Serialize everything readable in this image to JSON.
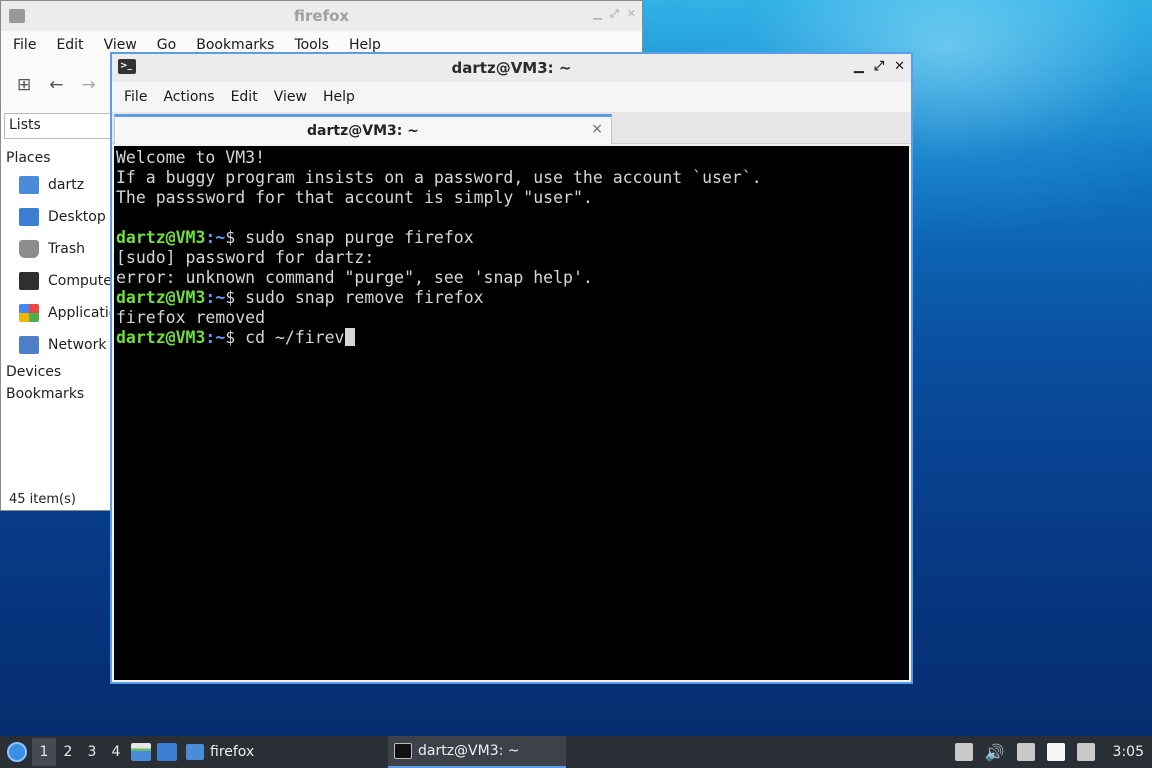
{
  "file_manager": {
    "title": "firefox",
    "menu": [
      "File",
      "Edit",
      "View",
      "Go",
      "Bookmarks",
      "Tools",
      "Help"
    ],
    "view_selector": "Lists",
    "places_header": "Places",
    "places": [
      "dartz",
      "Desktop",
      "Trash",
      "Computer",
      "Applications",
      "Network"
    ],
    "devices_header": "Devices",
    "bookmarks_header": "Bookmarks",
    "status": "45 item(s)"
  },
  "terminal": {
    "title": "dartz@VM3: ~",
    "menu": [
      "File",
      "Actions",
      "Edit",
      "View",
      "Help"
    ],
    "tab_label": "dartz@VM3: ~",
    "tab_close": "×",
    "lines": [
      "Welcome to VM3!",
      "If a buggy program insists on a password, use the account `user`.",
      "The passsword for that account is simply \"user\".",
      "",
      "[sudo] password for dartz:",
      "error: unknown command \"purge\", see 'snap help'.",
      "firefox removed"
    ],
    "prompt_user": "dartz@VM3",
    "prompt_path": ":~",
    "prompt_sign": "$ ",
    "commands": [
      "sudo snap purge firefox",
      "sudo snap remove firefox",
      "cd ~/firev"
    ]
  },
  "taskbar": {
    "workspaces": [
      "1",
      "2",
      "3",
      "4"
    ],
    "tasks": [
      "firefox",
      "dartz@VM3: ~"
    ],
    "clock": "3:05"
  }
}
